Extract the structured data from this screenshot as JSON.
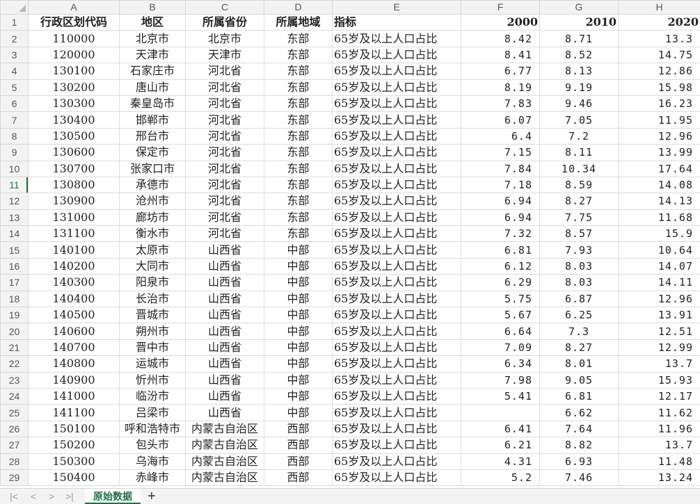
{
  "columns": [
    "A",
    "B",
    "C",
    "D",
    "E",
    "F",
    "G",
    "H"
  ],
  "headers": [
    "行政区划代码",
    "地区",
    "所属省份",
    "所属地域",
    "指标",
    "2000",
    "2010",
    "2020"
  ],
  "selected_row": 11,
  "rows": [
    {
      "num": "2",
      "a": "110000",
      "b": "北京市",
      "c": "北京市",
      "d": "东部",
      "e": "65岁及以上人口占比",
      "f": "8.42",
      "g": "8.71",
      "h": "13.3"
    },
    {
      "num": "3",
      "a": "120000",
      "b": "天津市",
      "c": "天津市",
      "d": "东部",
      "e": "65岁及以上人口占比",
      "f": "8.41",
      "g": "8.52",
      "h": "14.75"
    },
    {
      "num": "4",
      "a": "130100",
      "b": "石家庄市",
      "c": "河北省",
      "d": "东部",
      "e": "65岁及以上人口占比",
      "f": "6.77",
      "g": "8.13",
      "h": "12.86"
    },
    {
      "num": "5",
      "a": "130200",
      "b": "唐山市",
      "c": "河北省",
      "d": "东部",
      "e": "65岁及以上人口占比",
      "f": "8.19",
      "g": "9.19",
      "h": "15.98"
    },
    {
      "num": "6",
      "a": "130300",
      "b": "秦皇岛市",
      "c": "河北省",
      "d": "东部",
      "e": "65岁及以上人口占比",
      "f": "7.83",
      "g": "9.46",
      "h": "16.23"
    },
    {
      "num": "7",
      "a": "130400",
      "b": "邯郸市",
      "c": "河北省",
      "d": "东部",
      "e": "65岁及以上人口占比",
      "f": "6.07",
      "g": "7.05",
      "h": "11.95"
    },
    {
      "num": "8",
      "a": "130500",
      "b": "邢台市",
      "c": "河北省",
      "d": "东部",
      "e": "65岁及以上人口占比",
      "f": "6.4",
      "g": "7.2",
      "h": "12.96"
    },
    {
      "num": "9",
      "a": "130600",
      "b": "保定市",
      "c": "河北省",
      "d": "东部",
      "e": "65岁及以上人口占比",
      "f": "7.15",
      "g": "8.11",
      "h": "13.99"
    },
    {
      "num": "10",
      "a": "130700",
      "b": "张家口市",
      "c": "河北省",
      "d": "东部",
      "e": "65岁及以上人口占比",
      "f": "7.84",
      "g": "10.34",
      "h": "17.64"
    },
    {
      "num": "11",
      "a": "130800",
      "b": "承德市",
      "c": "河北省",
      "d": "东部",
      "e": "65岁及以上人口占比",
      "f": "7.18",
      "g": "8.59",
      "h": "14.08"
    },
    {
      "num": "12",
      "a": "130900",
      "b": "沧州市",
      "c": "河北省",
      "d": "东部",
      "e": "65岁及以上人口占比",
      "f": "6.94",
      "g": "8.27",
      "h": "14.13"
    },
    {
      "num": "13",
      "a": "131000",
      "b": "廊坊市",
      "c": "河北省",
      "d": "东部",
      "e": "65岁及以上人口占比",
      "f": "6.94",
      "g": "7.75",
      "h": "11.68"
    },
    {
      "num": "14",
      "a": "131100",
      "b": "衡水市",
      "c": "河北省",
      "d": "东部",
      "e": "65岁及以上人口占比",
      "f": "7.32",
      "g": "8.57",
      "h": "15.9"
    },
    {
      "num": "15",
      "a": "140100",
      "b": "太原市",
      "c": "山西省",
      "d": "中部",
      "e": "65岁及以上人口占比",
      "f": "6.81",
      "g": "7.93",
      "h": "10.64"
    },
    {
      "num": "16",
      "a": "140200",
      "b": "大同市",
      "c": "山西省",
      "d": "中部",
      "e": "65岁及以上人口占比",
      "f": "6.12",
      "g": "8.03",
      "h": "14.07"
    },
    {
      "num": "17",
      "a": "140300",
      "b": "阳泉市",
      "c": "山西省",
      "d": "中部",
      "e": "65岁及以上人口占比",
      "f": "6.29",
      "g": "8.03",
      "h": "14.11"
    },
    {
      "num": "18",
      "a": "140400",
      "b": "长治市",
      "c": "山西省",
      "d": "中部",
      "e": "65岁及以上人口占比",
      "f": "5.75",
      "g": "6.87",
      "h": "12.96"
    },
    {
      "num": "19",
      "a": "140500",
      "b": "晋城市",
      "c": "山西省",
      "d": "中部",
      "e": "65岁及以上人口占比",
      "f": "5.67",
      "g": "6.25",
      "h": "13.91"
    },
    {
      "num": "20",
      "a": "140600",
      "b": "朔州市",
      "c": "山西省",
      "d": "中部",
      "e": "65岁及以上人口占比",
      "f": "6.64",
      "g": "7.3",
      "h": "12.51"
    },
    {
      "num": "21",
      "a": "140700",
      "b": "晋中市",
      "c": "山西省",
      "d": "中部",
      "e": "65岁及以上人口占比",
      "f": "7.09",
      "g": "8.27",
      "h": "12.99"
    },
    {
      "num": "22",
      "a": "140800",
      "b": "运城市",
      "c": "山西省",
      "d": "中部",
      "e": "65岁及以上人口占比",
      "f": "6.34",
      "g": "8.01",
      "h": "13.7"
    },
    {
      "num": "23",
      "a": "140900",
      "b": "忻州市",
      "c": "山西省",
      "d": "中部",
      "e": "65岁及以上人口占比",
      "f": "7.98",
      "g": "9.05",
      "h": "15.93"
    },
    {
      "num": "24",
      "a": "141000",
      "b": "临汾市",
      "c": "山西省",
      "d": "中部",
      "e": "65岁及以上人口占比",
      "f": "5.41",
      "g": "6.81",
      "h": "12.17"
    },
    {
      "num": "25",
      "a": "141100",
      "b": "吕梁市",
      "c": "山西省",
      "d": "中部",
      "e": "65岁及以上人口占比",
      "f": "",
      "g": "6.62",
      "h": "11.62"
    },
    {
      "num": "26",
      "a": "150100",
      "b": "呼和浩特市",
      "c": "内蒙古自治区",
      "d": "西部",
      "e": "65岁及以上人口占比",
      "f": "6.41",
      "g": "7.64",
      "h": "11.96"
    },
    {
      "num": "27",
      "a": "150200",
      "b": "包头市",
      "c": "内蒙古自治区",
      "d": "西部",
      "e": "65岁及以上人口占比",
      "f": "6.21",
      "g": "8.82",
      "h": "13.7"
    },
    {
      "num": "28",
      "a": "150300",
      "b": "乌海市",
      "c": "内蒙古自治区",
      "d": "西部",
      "e": "65岁及以上人口占比",
      "f": "4.31",
      "g": "6.93",
      "h": "11.48"
    },
    {
      "num": "29",
      "a": "150400",
      "b": "赤峰市",
      "c": "内蒙古自治区",
      "d": "西部",
      "e": "65岁及以上人口占比",
      "f": "5.2",
      "g": "7.46",
      "h": "13.24"
    }
  ],
  "tabbar": {
    "nav_first": "|<",
    "nav_prev": "<",
    "nav_next": ">",
    "nav_last": ">|",
    "sheet_name": "原始数据",
    "add_label": "+"
  }
}
